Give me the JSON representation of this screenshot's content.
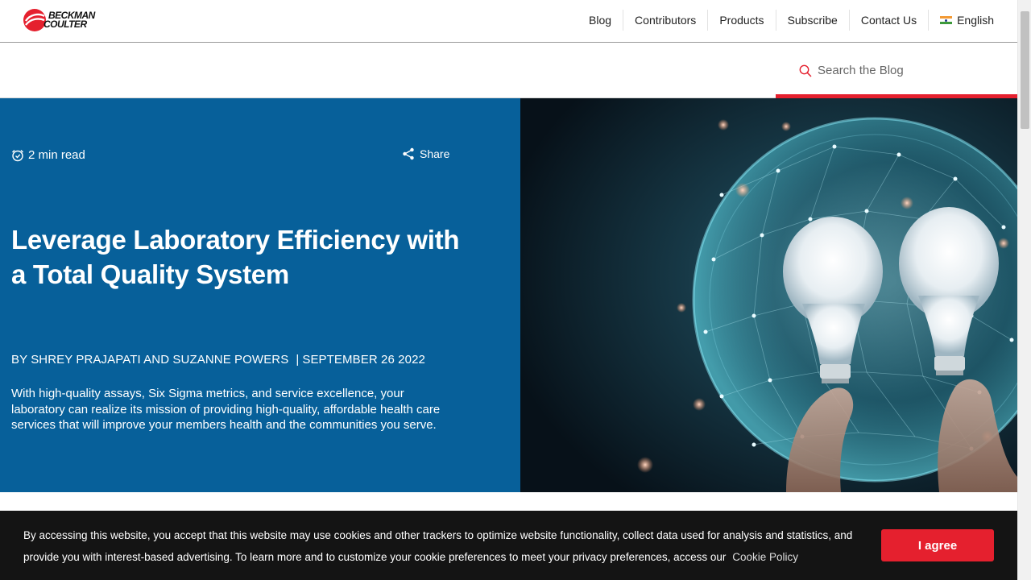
{
  "brand": {
    "line1": "BECKMAN",
    "line2": "COULTER",
    "color": "#e5202e"
  },
  "nav": {
    "items": [
      {
        "label": "Blog"
      },
      {
        "label": "Contributors"
      },
      {
        "label": "Products"
      },
      {
        "label": "Subscribe"
      },
      {
        "label": "Contact Us"
      }
    ],
    "language": "English"
  },
  "search": {
    "placeholder": "Search the Blog",
    "icon": "search-icon"
  },
  "article": {
    "read_time": "2 min read",
    "share_label": "Share",
    "title": "Leverage Laboratory Efficiency with a Total Quality System",
    "authors": "BY SHREY PRAJAPATI AND SUZANNE POWERS",
    "date": "SEPTEMBER 26 2022",
    "summary": "With high-quality assays, Six Sigma metrics, and service excellence, your laboratory can realize its mission of providing high-quality, affordable health care services that will improve your members health and the communities you serve."
  },
  "cookie": {
    "text": "By accessing this website, you accept that this website may use cookies and other trackers to optimize website functionality, collect data used for analysis and statistics, and provide you with interest-based advertising. To learn more and to customize your cookie preferences to meet your privacy preferences, access our",
    "link": "Cookie Policy",
    "button": "I agree"
  },
  "colors": {
    "hero_blue": "#07609a",
    "accent_red": "#e5202e",
    "cookie_bg": "#141414"
  }
}
